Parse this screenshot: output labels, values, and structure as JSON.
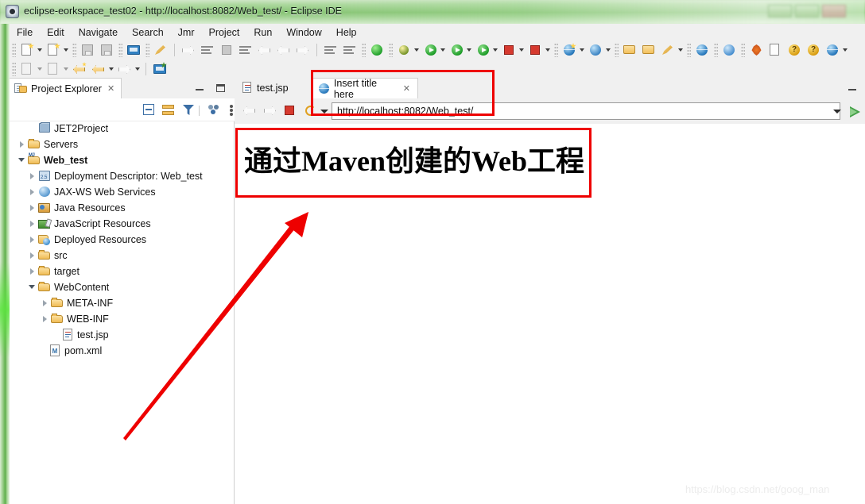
{
  "window": {
    "title": "eclipse-eorkspace_test02 - http://localhost:8082/Web_test/ - Eclipse IDE",
    "app_icon": "eclipse-icon"
  },
  "menubar": {
    "items": [
      {
        "label": "File"
      },
      {
        "label": "Edit"
      },
      {
        "label": "Navigate"
      },
      {
        "label": "Search"
      },
      {
        "label": "Jmr"
      },
      {
        "label": "Project"
      },
      {
        "label": "Run"
      },
      {
        "label": "Window"
      },
      {
        "label": "Help"
      }
    ]
  },
  "toolbar_row1": {
    "items": [
      {
        "name": "new-wizard-icon",
        "kind": "doc-star",
        "dropdown": true
      },
      {
        "name": "new-java-class-icon",
        "kind": "doc2-star",
        "dropdown": true
      },
      {
        "name": "save-icon",
        "kind": "disk",
        "dropdown": false
      },
      {
        "name": "save-all-icon",
        "kind": "disk-multi",
        "dropdown": false
      },
      {
        "name": "print-icon",
        "kind": "screen",
        "dropdown": false
      },
      {
        "name": "link-editor-icon",
        "kind": "pen",
        "dropdown": false
      },
      {
        "name": "step-into-icon",
        "kind": "step",
        "dropdown": false
      },
      {
        "name": "pause-icon",
        "kind": "pause",
        "dropdown": false
      },
      {
        "name": "terminate-icon",
        "kind": "stop-dim",
        "dropdown": false
      },
      {
        "name": "step-filters-icon",
        "kind": "branch",
        "dropdown": false
      },
      {
        "name": "step-over-icon",
        "kind": "arc1",
        "dropdown": false
      },
      {
        "name": "step-return-icon",
        "kind": "arc2",
        "dropdown": false
      },
      {
        "name": "step-out-icon",
        "kind": "arc3",
        "dropdown": false
      },
      {
        "name": "toggle-breakpoint-icon",
        "kind": "lines",
        "dropdown": false
      },
      {
        "name": "skip-breakpoints-icon",
        "kind": "lines2",
        "dropdown": false
      },
      {
        "name": "open-task-icon",
        "kind": "lines3",
        "dropdown": false
      },
      {
        "name": "power-icon",
        "kind": "power",
        "dropdown": false
      },
      {
        "name": "debug-icon",
        "kind": "bug",
        "dropdown": true
      },
      {
        "name": "run-icon",
        "kind": "play",
        "dropdown": true
      },
      {
        "name": "run-as-server-icon",
        "kind": "play-server",
        "dropdown": true
      },
      {
        "name": "run-external-icon",
        "kind": "play-ext",
        "dropdown": true
      },
      {
        "name": "stop-server-icon",
        "kind": "stop-red",
        "dropdown": true
      },
      {
        "name": "publish-icon",
        "kind": "stop-play",
        "dropdown": true
      },
      {
        "name": "open-web-browser-icon",
        "kind": "globe-star",
        "dropdown": true
      },
      {
        "name": "search-scm-icon",
        "kind": "s-badge",
        "dropdown": true
      },
      {
        "name": "open-type-icon",
        "kind": "folder-ball",
        "dropdown": false
      },
      {
        "name": "open-resource-icon",
        "kind": "folder-open",
        "dropdown": false
      },
      {
        "name": "brush-icon",
        "kind": "brush",
        "dropdown": true
      },
      {
        "name": "web-perspective-icon",
        "kind": "globe",
        "dropdown": false
      },
      {
        "name": "profile-icon",
        "kind": "profile",
        "dropdown": false
      },
      {
        "name": "tomcat-icon",
        "kind": "leaf",
        "dropdown": false
      },
      {
        "name": "binary-file-icon",
        "kind": "doc010",
        "dropdown": false
      },
      {
        "name": "help-search-icon",
        "kind": "qmark-blue",
        "dropdown": false
      },
      {
        "name": "help-icon",
        "kind": "qmark",
        "dropdown": false
      },
      {
        "name": "web-tools-icon",
        "kind": "globe",
        "dropdown": true
      },
      {
        "name": "connect-icon",
        "kind": "connect",
        "dropdown": false
      }
    ]
  },
  "toolbar_row2": {
    "items": [
      {
        "name": "import-icon",
        "kind": "doc-down",
        "dropdown": true
      },
      {
        "name": "export-icon",
        "kind": "doc-up",
        "dropdown": true
      },
      {
        "name": "back-history-icon",
        "kind": "hand-left-star",
        "dropdown": false
      },
      {
        "name": "previous-annotation-icon",
        "kind": "hand-left",
        "dropdown": true
      },
      {
        "name": "next-annotation-icon",
        "kind": "hand-right-out",
        "dropdown": true
      },
      {
        "name": "new-server-icon",
        "kind": "screen-plus",
        "dropdown": false
      }
    ]
  },
  "project_explorer": {
    "tab_label": "Project Explorer",
    "close_glyph": "✕",
    "toolbar": [
      {
        "name": "collapse-all-button"
      },
      {
        "name": "link-with-editor-button"
      },
      {
        "name": "filter-button"
      },
      {
        "name": "working-sets-button"
      },
      {
        "name": "view-menu-button"
      }
    ],
    "minimize_glyph": "minimize",
    "maximize_glyph": "maximize",
    "tree": [
      {
        "label": "JET2Project",
        "indent": 0,
        "twisty": "none",
        "icon": "project-closed-icon"
      },
      {
        "label": "Servers",
        "indent": 0,
        "twisty": "closed",
        "icon": "folder-open-icon"
      },
      {
        "label": "Web_test",
        "indent": 0,
        "twisty": "open",
        "icon": "maven-project-icon"
      },
      {
        "label": "Deployment Descriptor: Web_test",
        "indent": 1,
        "twisty": "closed",
        "icon": "deployment-descriptor-icon"
      },
      {
        "label": "JAX-WS Web Services",
        "indent": 1,
        "twisty": "closed",
        "icon": "web-services-icon"
      },
      {
        "label": "Java Resources",
        "indent": 1,
        "twisty": "closed",
        "icon": "java-resources-icon"
      },
      {
        "label": "JavaScript Resources",
        "indent": 1,
        "twisty": "closed",
        "icon": "javascript-resources-icon"
      },
      {
        "label": "Deployed Resources",
        "indent": 1,
        "twisty": "closed",
        "icon": "deployed-resources-icon"
      },
      {
        "label": "src",
        "indent": 1,
        "twisty": "closed",
        "icon": "folder-open-icon"
      },
      {
        "label": "target",
        "indent": 1,
        "twisty": "closed",
        "icon": "folder-open-icon"
      },
      {
        "label": "WebContent",
        "indent": 1,
        "twisty": "open",
        "icon": "folder-open-icon"
      },
      {
        "label": "META-INF",
        "indent": 2,
        "twisty": "closed",
        "icon": "folder-open-icon"
      },
      {
        "label": "WEB-INF",
        "indent": 2,
        "twisty": "closed",
        "icon": "folder-open-icon"
      },
      {
        "label": "test.jsp",
        "indent": 2,
        "twisty": "none",
        "icon": "jsp-file-icon"
      },
      {
        "label": "pom.xml",
        "indent": 1,
        "twisty": "none",
        "icon": "pom-file-icon"
      }
    ]
  },
  "editor": {
    "tabs": [
      {
        "label": "test.jsp",
        "icon": "jsp-file-icon",
        "active": false,
        "close_glyph": ""
      },
      {
        "label": "Insert title here",
        "icon": "globe-icon",
        "active": true,
        "close_glyph": "✕"
      }
    ],
    "minimize_glyph": "minimize",
    "browser": {
      "back_icon": "back-arrow-icon",
      "forward_icon": "forward-arrow-icon",
      "stop_icon": "stop-icon",
      "refresh_icon": "refresh-icon",
      "dropdown_icon": "chevron-down-icon",
      "url_value": "http://localhost:8082/Web_test/",
      "url_placeholder": "http://",
      "go_icon": "go-play-icon"
    },
    "page": {
      "heading": "通过Maven创建的Web工程"
    }
  },
  "annotations": {
    "box_tab": "red-highlight-box",
    "box_heading": "red-highlight-box",
    "arrow": "red-arrow-annotation",
    "arrow_color": "#ee0000"
  },
  "watermark": {
    "text": "https://blog.csdn.net/goog_man"
  },
  "colors": {
    "titlebar_green": "#7fc06b",
    "chrome_gray": "#f0f0f0",
    "annotation_red": "#ee0000",
    "accent_blue": "#3b6ea5"
  }
}
